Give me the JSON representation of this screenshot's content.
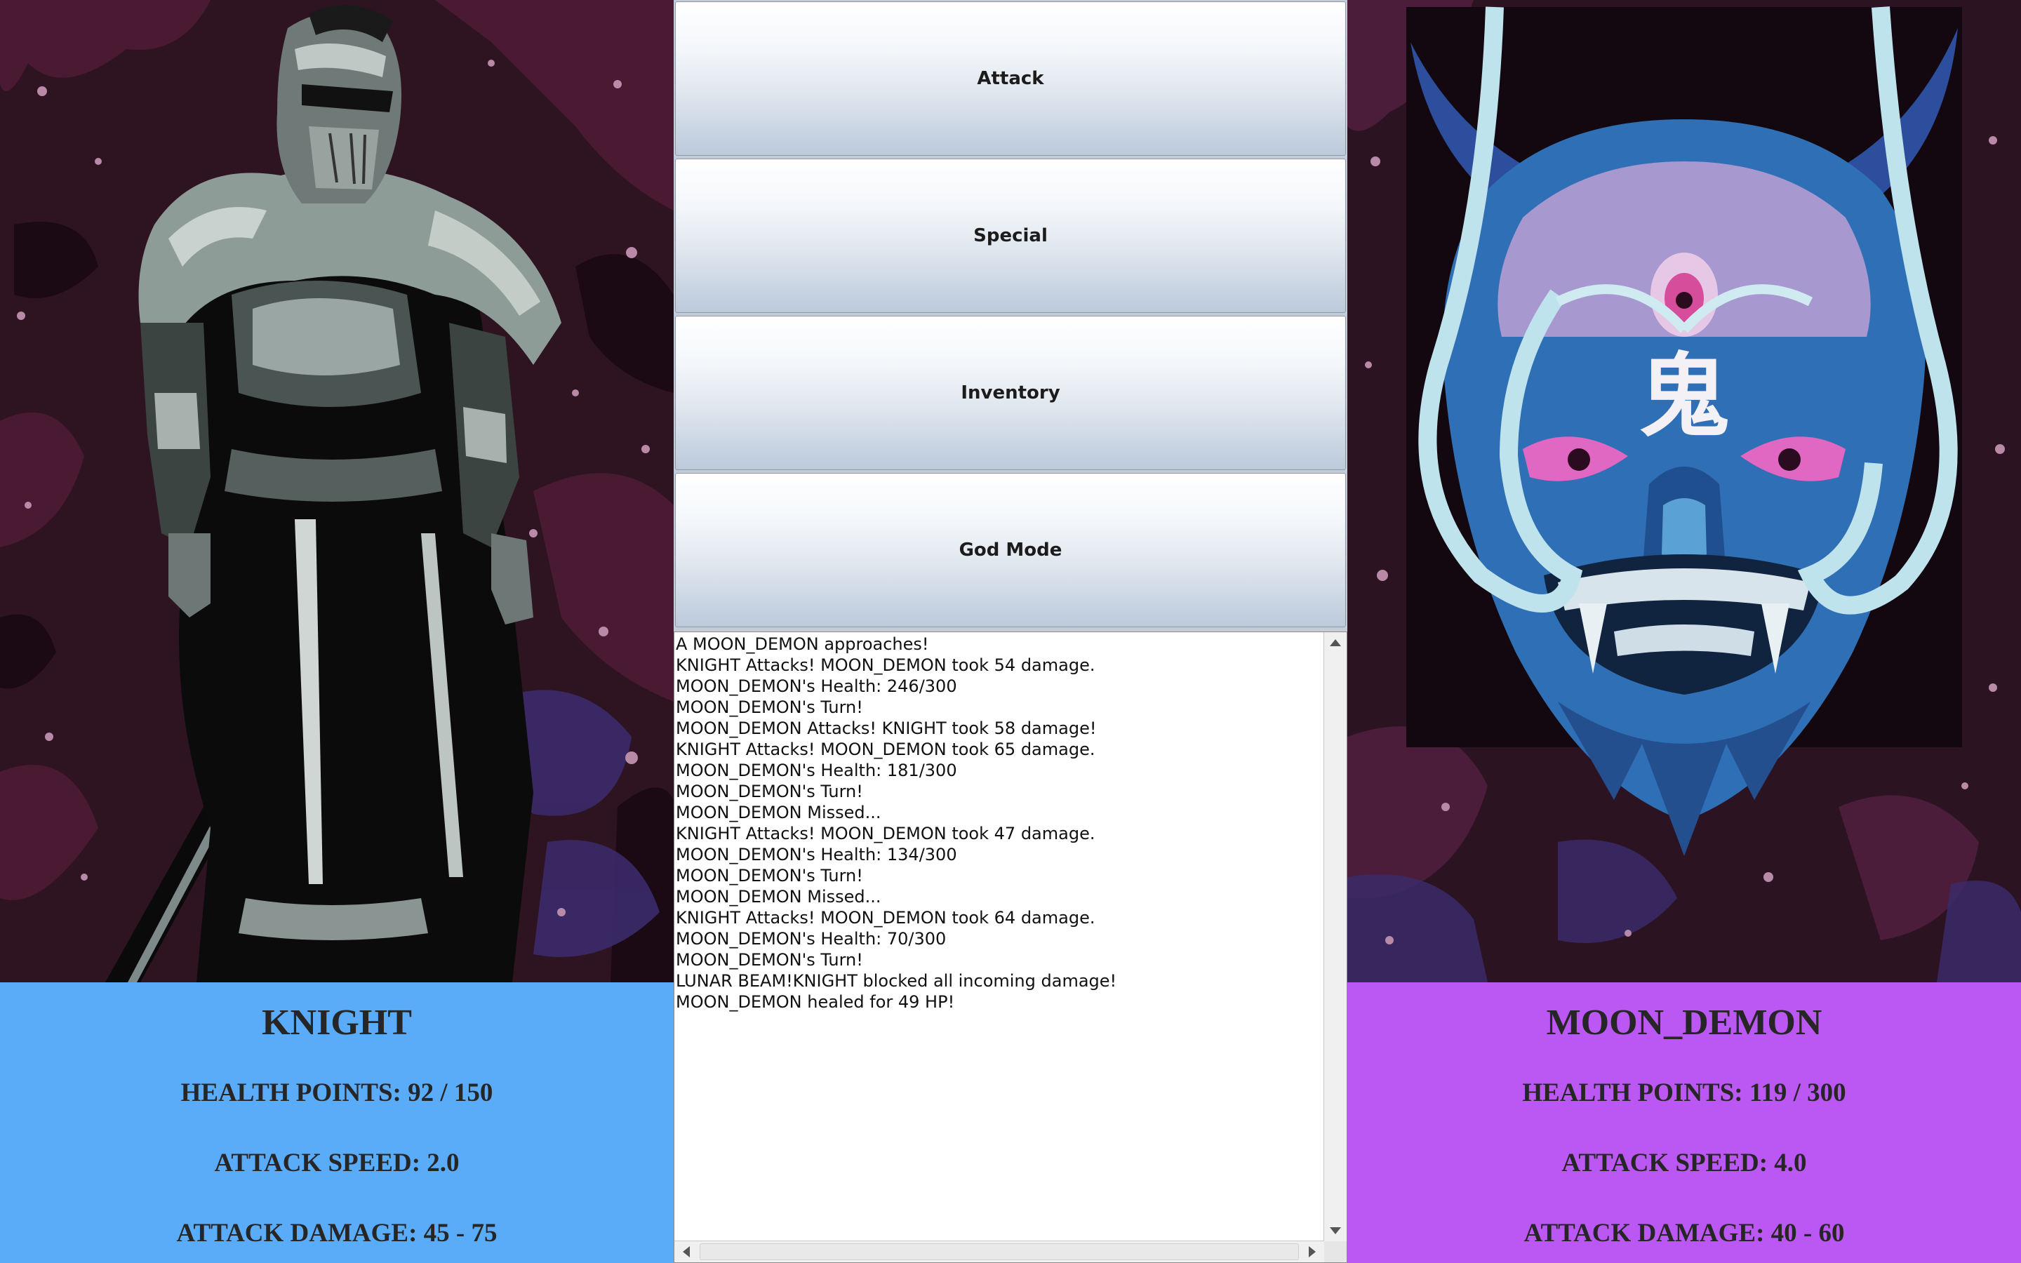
{
  "player": {
    "name": "KNIGHT",
    "health_label": "HEALTH POINTS: 92 / 150",
    "speed_label": "ATTACK SPEED: 2.0",
    "damage_label": "ATTACK DAMAGE: 45 - 75",
    "panel_color": "#5aabf8"
  },
  "enemy": {
    "name": "MOON_DEMON",
    "health_label": "HEALTH POINTS: 119 / 300",
    "speed_label": "ATTACK SPEED: 4.0",
    "damage_label": "ATTACK DAMAGE: 40 - 60",
    "panel_color": "#bb57f2",
    "mask_glyph": "鬼"
  },
  "actions": {
    "attack": "Attack",
    "special": "Special",
    "inventory": "Inventory",
    "god_mode": "God Mode"
  },
  "log": [
    "A MOON_DEMON approaches!",
    "KNIGHT Attacks! MOON_DEMON took 54 damage.",
    "MOON_DEMON's Health: 246/300",
    "MOON_DEMON's Turn!",
    "MOON_DEMON Attacks! KNIGHT took 58 damage!",
    "KNIGHT Attacks! MOON_DEMON took 65 damage.",
    "MOON_DEMON's Health: 181/300",
    "MOON_DEMON's Turn!",
    "MOON_DEMON Missed...",
    "KNIGHT Attacks! MOON_DEMON took 47 damage.",
    "MOON_DEMON's Health: 134/300",
    "MOON_DEMON's Turn!",
    "MOON_DEMON Missed...",
    "KNIGHT Attacks! MOON_DEMON took 64 damage.",
    "MOON_DEMON's Health: 70/300",
    "MOON_DEMON's Turn!",
    "LUNAR BEAM!KNIGHT blocked all incoming damage!",
    "MOON_DEMON healed for 49 HP!"
  ]
}
